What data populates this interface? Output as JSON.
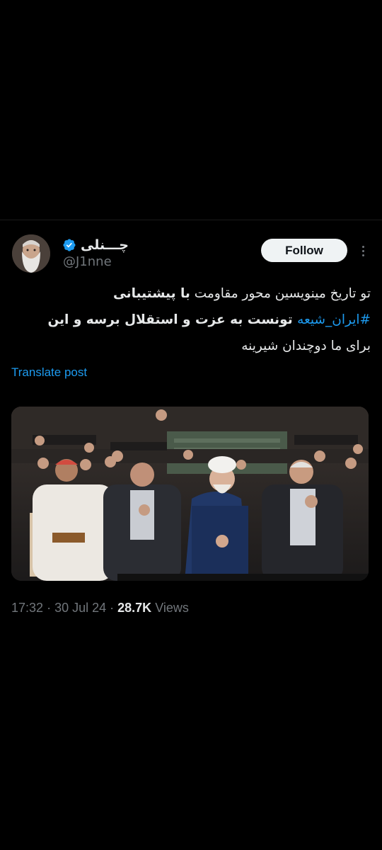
{
  "author": {
    "display_name": "چـــنلی",
    "handle": "@J1nne",
    "verified": true
  },
  "follow_label": "Follow",
  "post": {
    "line1": "تو تاریخ مینویسین محور مقاومت ",
    "line1_bold": "با پیشتیبانی",
    "line2_hashtag": "#ایران_شیعه",
    "line2_rest": " تونست به عزت و استقلال برسه و این",
    "line3": "برای ما دوچندان شیرینه"
  },
  "translate_label": "Translate post",
  "meta": {
    "time": "17:32",
    "date": "30 Jul 24",
    "views_count": "28.7K",
    "views_label": "Views"
  },
  "icons": {
    "verified": "verified-badge-icon",
    "more": "more-options-icon"
  },
  "colors": {
    "background": "#000000",
    "accent": "#1d9bf0",
    "secondary_text": "#71767b",
    "primary_text": "#e7e9ea"
  }
}
